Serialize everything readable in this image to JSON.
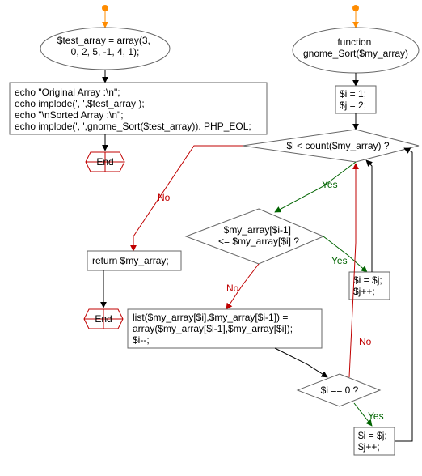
{
  "nodes": {
    "test_array": "$test_array = array(3,\n0, 2, 5, -1, 4, 1);",
    "echo_block": "echo \"Original Array :\\n\";\necho implode(', ',$test_array );\necho \"\\nSorted Array :\\n\";\necho implode(', ',gnome_Sort($test_array)). PHP_EOL;",
    "end1": "End",
    "func_decl": "function\ngnome_Sort($my_array)",
    "init_ij": "$i = 1;\n$j = 2;",
    "cond_i_lt_count": "$i < count($my_array) ?",
    "return_arr": "return $my_array;",
    "end2": "End",
    "cond_cmp": "$my_array[$i-1]\n<= $my_array[$i] ?",
    "assign_i_j_1": "$i = $j;\n$j++;",
    "swap_block": "list($my_array[$i],$my_array[$i-1]) =\narray($my_array[$i-1],$my_array[$i]);\n$i--;",
    "cond_i_zero": "$i == 0 ?",
    "assign_i_j_2": "$i = $j;\n$j++;"
  },
  "labels": {
    "yes": "Yes",
    "no": "No"
  },
  "colors": {
    "orange": "#ff8c00",
    "red": "#c00000",
    "green": "#006400",
    "box_stroke": "#666666",
    "dot_orange": "#ff8c00"
  }
}
